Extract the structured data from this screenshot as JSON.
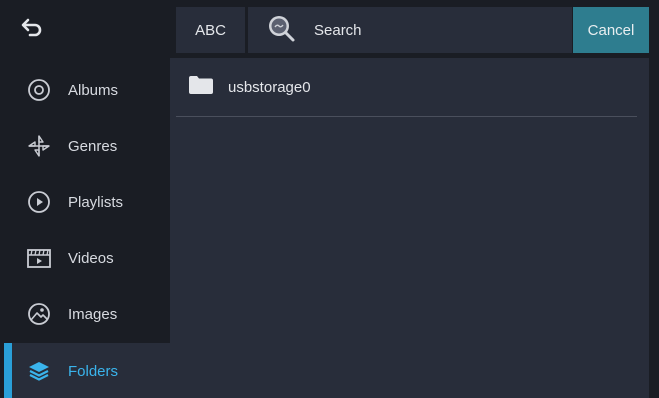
{
  "colors": {
    "background": "#1a1d24",
    "panel": "#282d3a",
    "accent": "#2a9fd8",
    "cancel": "#2e7d8f"
  },
  "header": {
    "back_icon": "back-arrow-icon",
    "sort_label": "ABC",
    "search": {
      "icon": "search-icon",
      "label": "Search"
    },
    "cancel_label": "Cancel"
  },
  "sidebar": {
    "items": [
      {
        "label": "Albums",
        "icon": "album-icon",
        "active": false
      },
      {
        "label": "Genres",
        "icon": "genres-icon",
        "active": false
      },
      {
        "label": "Playlists",
        "icon": "playlist-icon",
        "active": false
      },
      {
        "label": "Videos",
        "icon": "video-icon",
        "active": false
      },
      {
        "label": "Images",
        "icon": "image-icon",
        "active": false
      },
      {
        "label": "Folders",
        "icon": "folder-layers-icon",
        "active": true
      }
    ]
  },
  "main": {
    "folders": [
      {
        "name": "usbstorage0",
        "icon": "folder-icon"
      }
    ]
  }
}
